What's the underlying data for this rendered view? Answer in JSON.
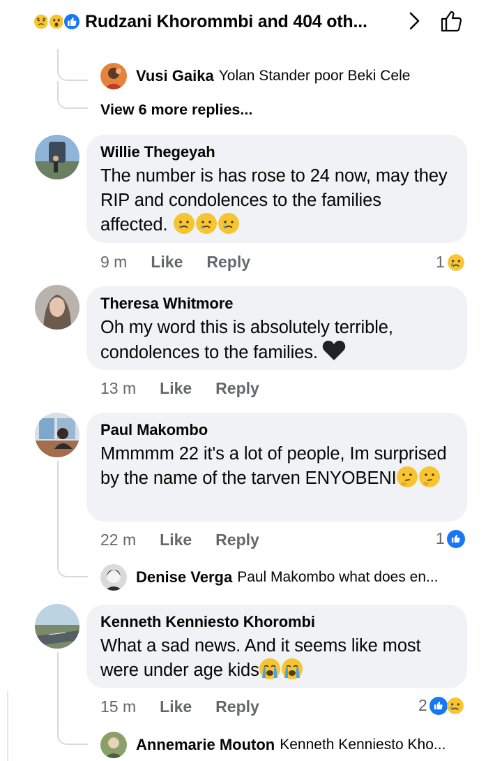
{
  "header": {
    "reactions": [
      "sad-face",
      "wow-face",
      "like-thumb"
    ],
    "title": "Rudzani Khorommbi and 404 oth...",
    "chevron_icon": "chevron-right-icon",
    "like_icon": "thumbs-up-outline-icon"
  },
  "top_reply": {
    "name": "Vusi Gaika",
    "text": "Yolan Stander poor Beki Cele"
  },
  "view_more": "View 6 more replies...",
  "comments": [
    {
      "author": "Willie Thegeyah",
      "text": "The number is has rose to 24 now, may they RIP and condolences to the families affected.",
      "time": "9 m",
      "like": "Like",
      "reply": "Reply",
      "reaction_count": "1",
      "reactions": [
        "sad-face"
      ]
    },
    {
      "author": "Theresa Whitmore",
      "text": "Oh my word this is absolutely terrible, condolences to the families.",
      "time": "13 m",
      "like": "Like",
      "reply": "Reply",
      "reaction_count": "",
      "reactions": []
    },
    {
      "author": "Paul Makombo",
      "text": "Mmmmm 22 it's a lot of people, Im surprised by the name of the tarven ENYOBENI",
      "time": "22 m",
      "like": "Like",
      "reply": "Reply",
      "reaction_count": "1",
      "reactions": [
        "like-thumb"
      ],
      "reply_preview": {
        "name": "Denise Verga",
        "text": "Paul Makombo what does en..."
      }
    },
    {
      "author": "Kenneth Kenniesto Khorombi",
      "text": "What a sad news. And it seems like most were under age kids",
      "time": "15 m",
      "like": "Like",
      "reply": "Reply",
      "reaction_count": "2",
      "reactions": [
        "like-thumb",
        "sad-face"
      ],
      "reply_preview": {
        "name": "Annemarie Mouton",
        "text": "Kenneth Kenniesto Kho..."
      }
    }
  ],
  "colors": {
    "bubble": "#f0f2f5",
    "meta_text": "#65676b",
    "like_blue": "#1877f2",
    "emoji_yellow": "#f7c531",
    "thread_line": "#d7d9dd"
  }
}
